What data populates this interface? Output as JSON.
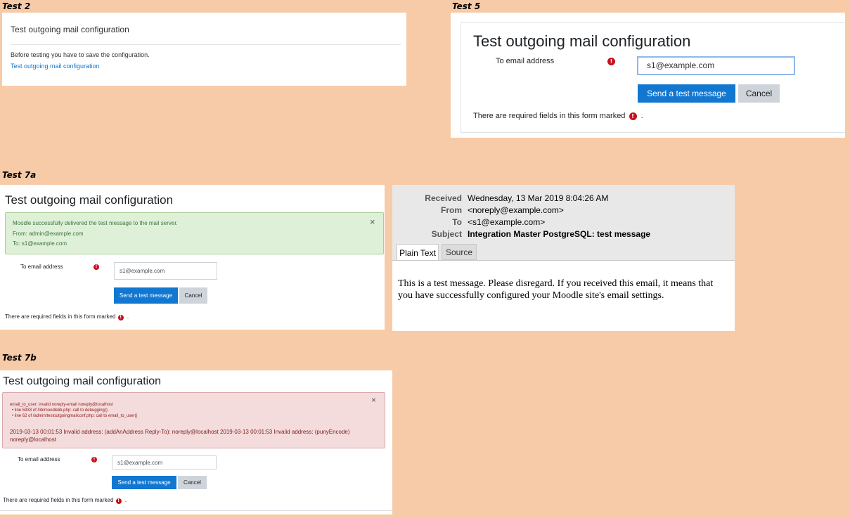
{
  "labels": {
    "test2": "Test 2",
    "test5": "Test 5",
    "test7a": "Test 7a",
    "test7b": "Test 7b"
  },
  "test2": {
    "heading": "Test outgoing mail configuration",
    "notice": "Before testing you have to save the configuration.",
    "link": "Test outgoing mail configuration"
  },
  "test5": {
    "heading": "Test outgoing mail configuration",
    "field_label": "To email address",
    "field_value": "s1@example.com",
    "send_label": "Send a test message",
    "cancel_label": "Cancel",
    "required_note": "There are required fields in this form marked",
    "required_tail": "."
  },
  "test7a": {
    "heading": "Test outgoing mail configuration",
    "alert_line1": "Moodle successfully delivered the test message to the mail server.",
    "alert_line2": "From: admin@example.com",
    "alert_line3": "To: s1@example.com",
    "close": "×",
    "field_label": "To email address",
    "field_value": "s1@example.com",
    "send_label": "Send a test message",
    "cancel_label": "Cancel",
    "required_note": "There are required fields in this form marked",
    "required_tail": "."
  },
  "email": {
    "received_label": "Received",
    "received_value": "Wednesday, 13 Mar 2019 8:04:26 AM",
    "from_label": "From",
    "from_value": "<noreply@example.com>",
    "to_label": "To",
    "to_value": "<s1@example.com>",
    "subject_label": "Subject",
    "subject_value": "Integration Master PostgreSQL: test message",
    "tab_plain": "Plain Text",
    "tab_source": "Source",
    "body": "This is a test message. Please disregard. If you received this email, it means that you have successfully configured your Moodle site's email settings."
  },
  "test7b": {
    "heading": "Test outgoing mail configuration",
    "err_line1": "email_to_user: invalid noreply-email noreply@localhost",
    "err_bullet1": "line 5933 of /lib/moodlelib.php: call to debugging()",
    "err_bullet2": "line 62 of /admin/testoutgoingmailconf.php: call to email_to_user()",
    "err_main": "2019-03-13 00:01:53 Invalid address: (addAnAddress Reply-To): noreply@localhost 2019-03-13 00:01:53 Invalid address: (punyEncode) noreply@localhost",
    "close": "×",
    "field_label": "To email address",
    "field_value": "s1@example.com",
    "send_label": "Send a test message",
    "cancel_label": "Cancel",
    "required_note": "There are required fields in this form marked",
    "required_tail": "."
  },
  "icons": {
    "required": "!"
  },
  "colors": {
    "background": "#f7cba8",
    "primary": "#1177d1",
    "secondary": "#ced4da",
    "required": "#c8101e",
    "success_bg": "#dff0d8",
    "danger_bg": "#f5dcdc",
    "link": "#1177d1"
  }
}
